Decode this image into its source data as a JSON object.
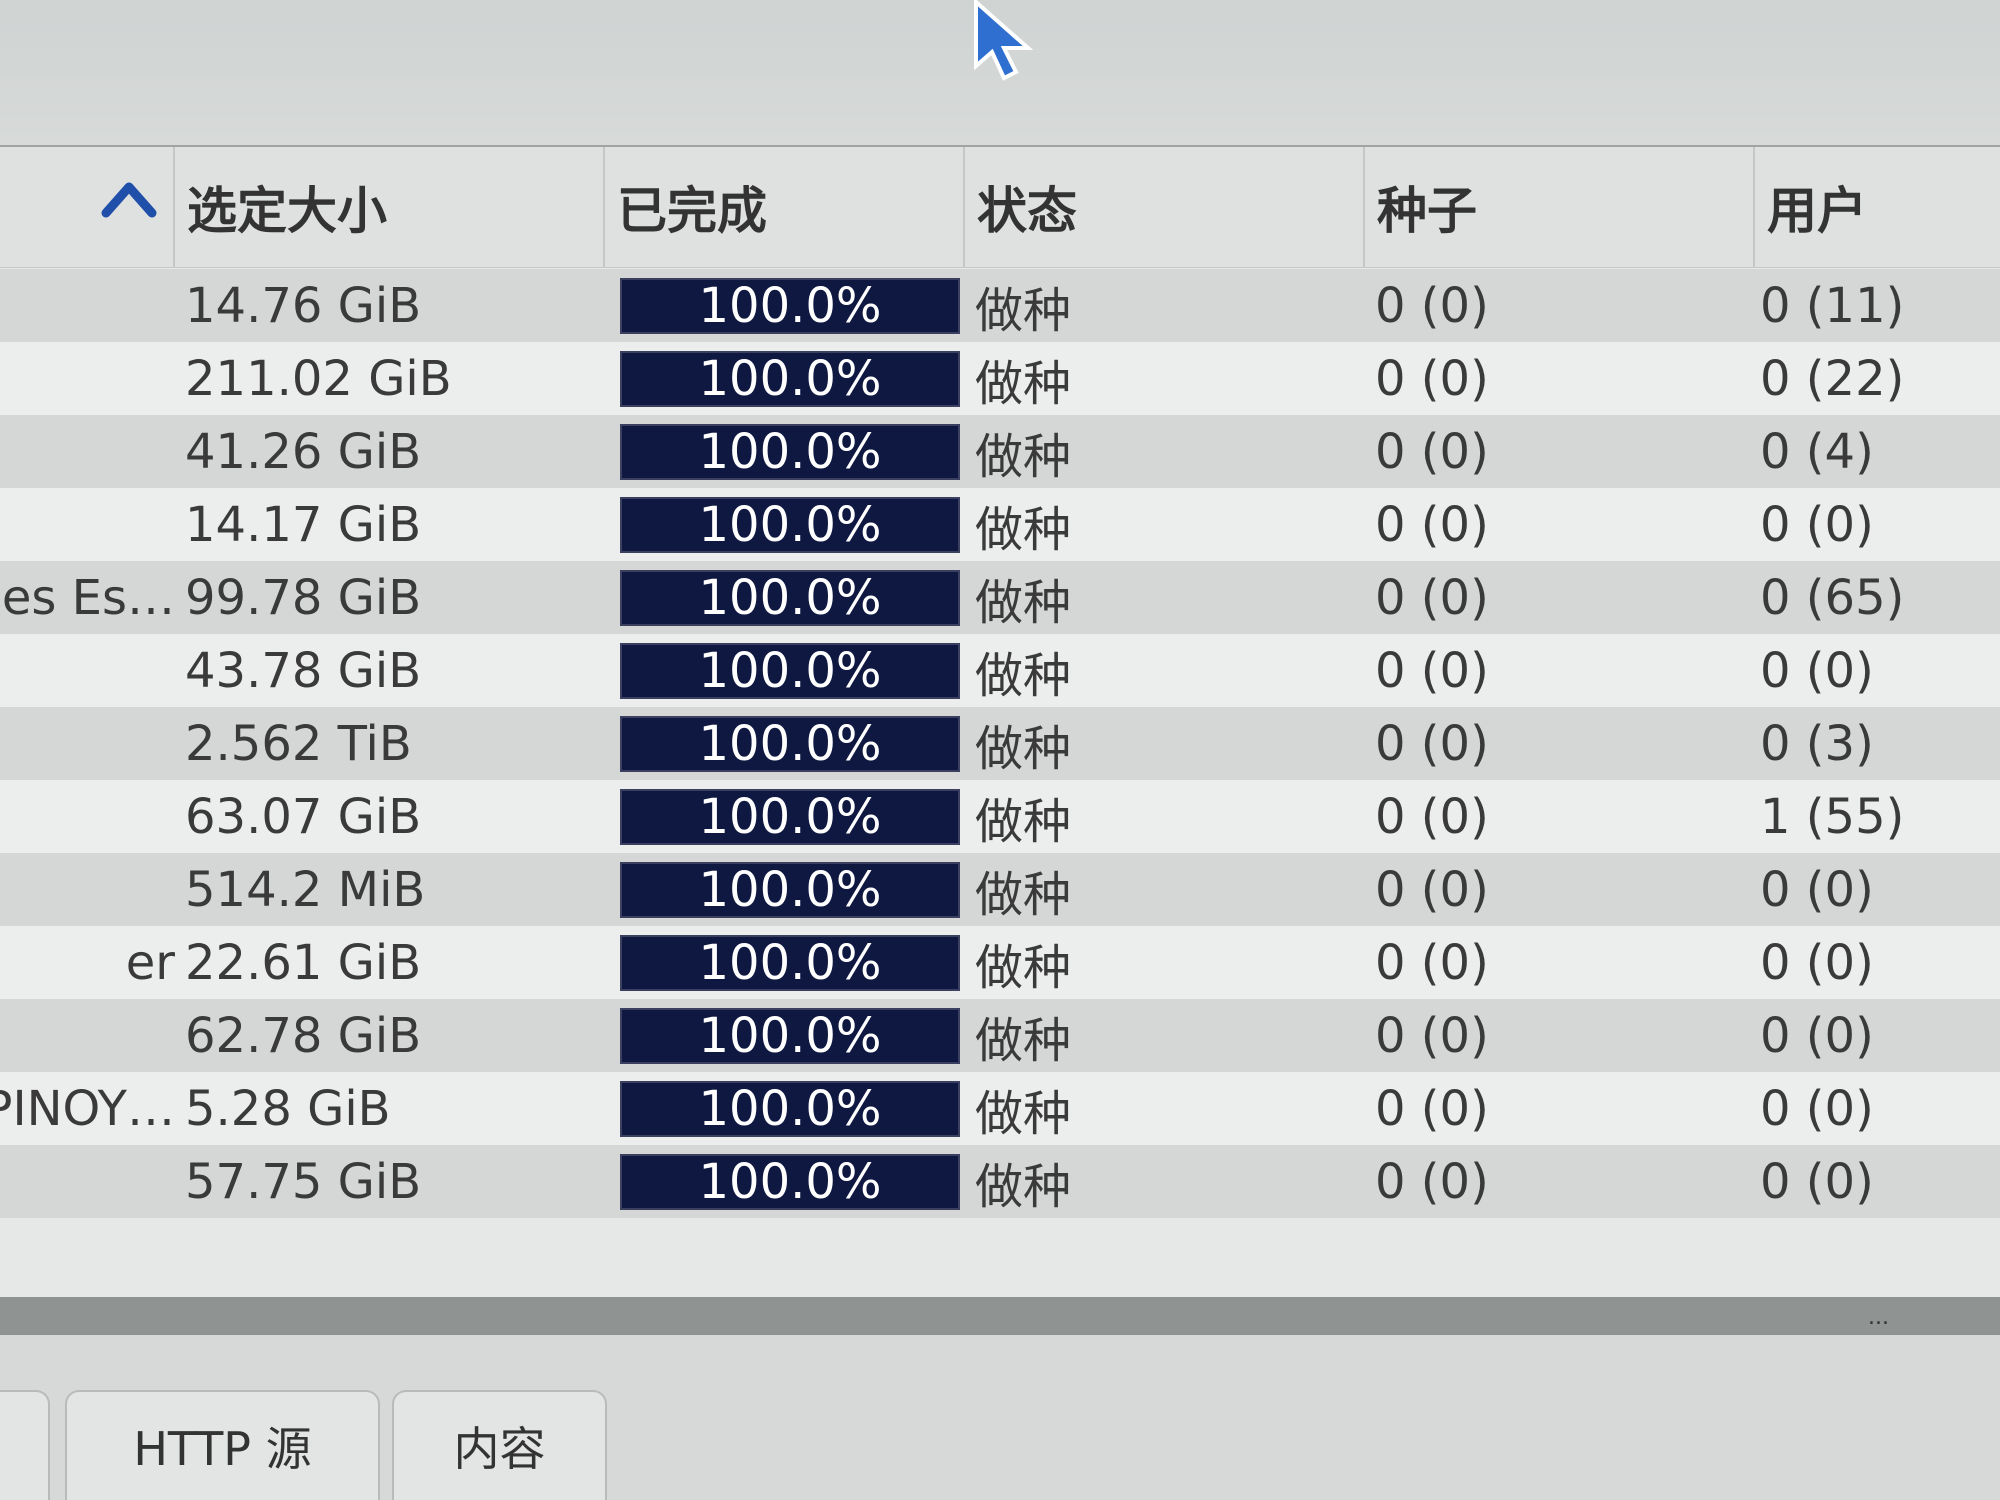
{
  "columns": {
    "size": "选定大小",
    "done": "已完成",
    "status": "状态",
    "seeds": "种子",
    "peers": "用户"
  },
  "rows": [
    {
      "name": "",
      "size": "14.76 GiB",
      "done": "100.0%",
      "status": "做种",
      "seeds": "0 (0)",
      "peers": "0 (11)"
    },
    {
      "name": "",
      "size": "211.02 GiB",
      "done": "100.0%",
      "status": "做种",
      "seeds": "0 (0)",
      "peers": "0 (22)"
    },
    {
      "name": "",
      "size": "41.26 GiB",
      "done": "100.0%",
      "status": "做种",
      "seeds": "0 (0)",
      "peers": "0 (4)"
    },
    {
      "name": "",
      "size": "14.17 GiB",
      "done": "100.0%",
      "status": "做种",
      "seeds": "0 (0)",
      "peers": "0 (0)"
    },
    {
      "name": "es Es…",
      "size": "99.78 GiB",
      "done": "100.0%",
      "status": "做种",
      "seeds": "0 (0)",
      "peers": "0 (65)"
    },
    {
      "name": "",
      "size": "43.78 GiB",
      "done": "100.0%",
      "status": "做种",
      "seeds": "0 (0)",
      "peers": "0 (0)"
    },
    {
      "name": "",
      "size": "2.562 TiB",
      "done": "100.0%",
      "status": "做种",
      "seeds": "0 (0)",
      "peers": "0 (3)"
    },
    {
      "name": "",
      "size": "63.07 GiB",
      "done": "100.0%",
      "status": "做种",
      "seeds": "0 (0)",
      "peers": "1 (55)"
    },
    {
      "name": "",
      "size": "514.2 MiB",
      "done": "100.0%",
      "status": "做种",
      "seeds": "0 (0)",
      "peers": "0 (0)"
    },
    {
      "name": "er",
      "size": "22.61 GiB",
      "done": "100.0%",
      "status": "做种",
      "seeds": "0 (0)",
      "peers": "0 (0)"
    },
    {
      "name": "",
      "size": "62.78 GiB",
      "done": "100.0%",
      "status": "做种",
      "seeds": "0 (0)",
      "peers": "0 (0)"
    },
    {
      "name": "PINOY…",
      "size": "5.28 GiB",
      "done": "100.0%",
      "status": "做种",
      "seeds": "0 (0)",
      "peers": "0 (0)"
    },
    {
      "name": "",
      "size": "57.75 GiB",
      "done": "100.0%",
      "status": "做种",
      "seeds": "0 (0)",
      "peers": "0 (0)"
    }
  ],
  "progress_fraction": 1.0,
  "tabs": [
    "HTTP 源",
    "内容"
  ],
  "more_indicator": "...",
  "colors": {
    "progress_bar": "#0e1840",
    "accent": "#1f4fa8"
  },
  "icons": {
    "sort": "chevron-up-icon",
    "cursor": "mouse-pointer-icon"
  }
}
